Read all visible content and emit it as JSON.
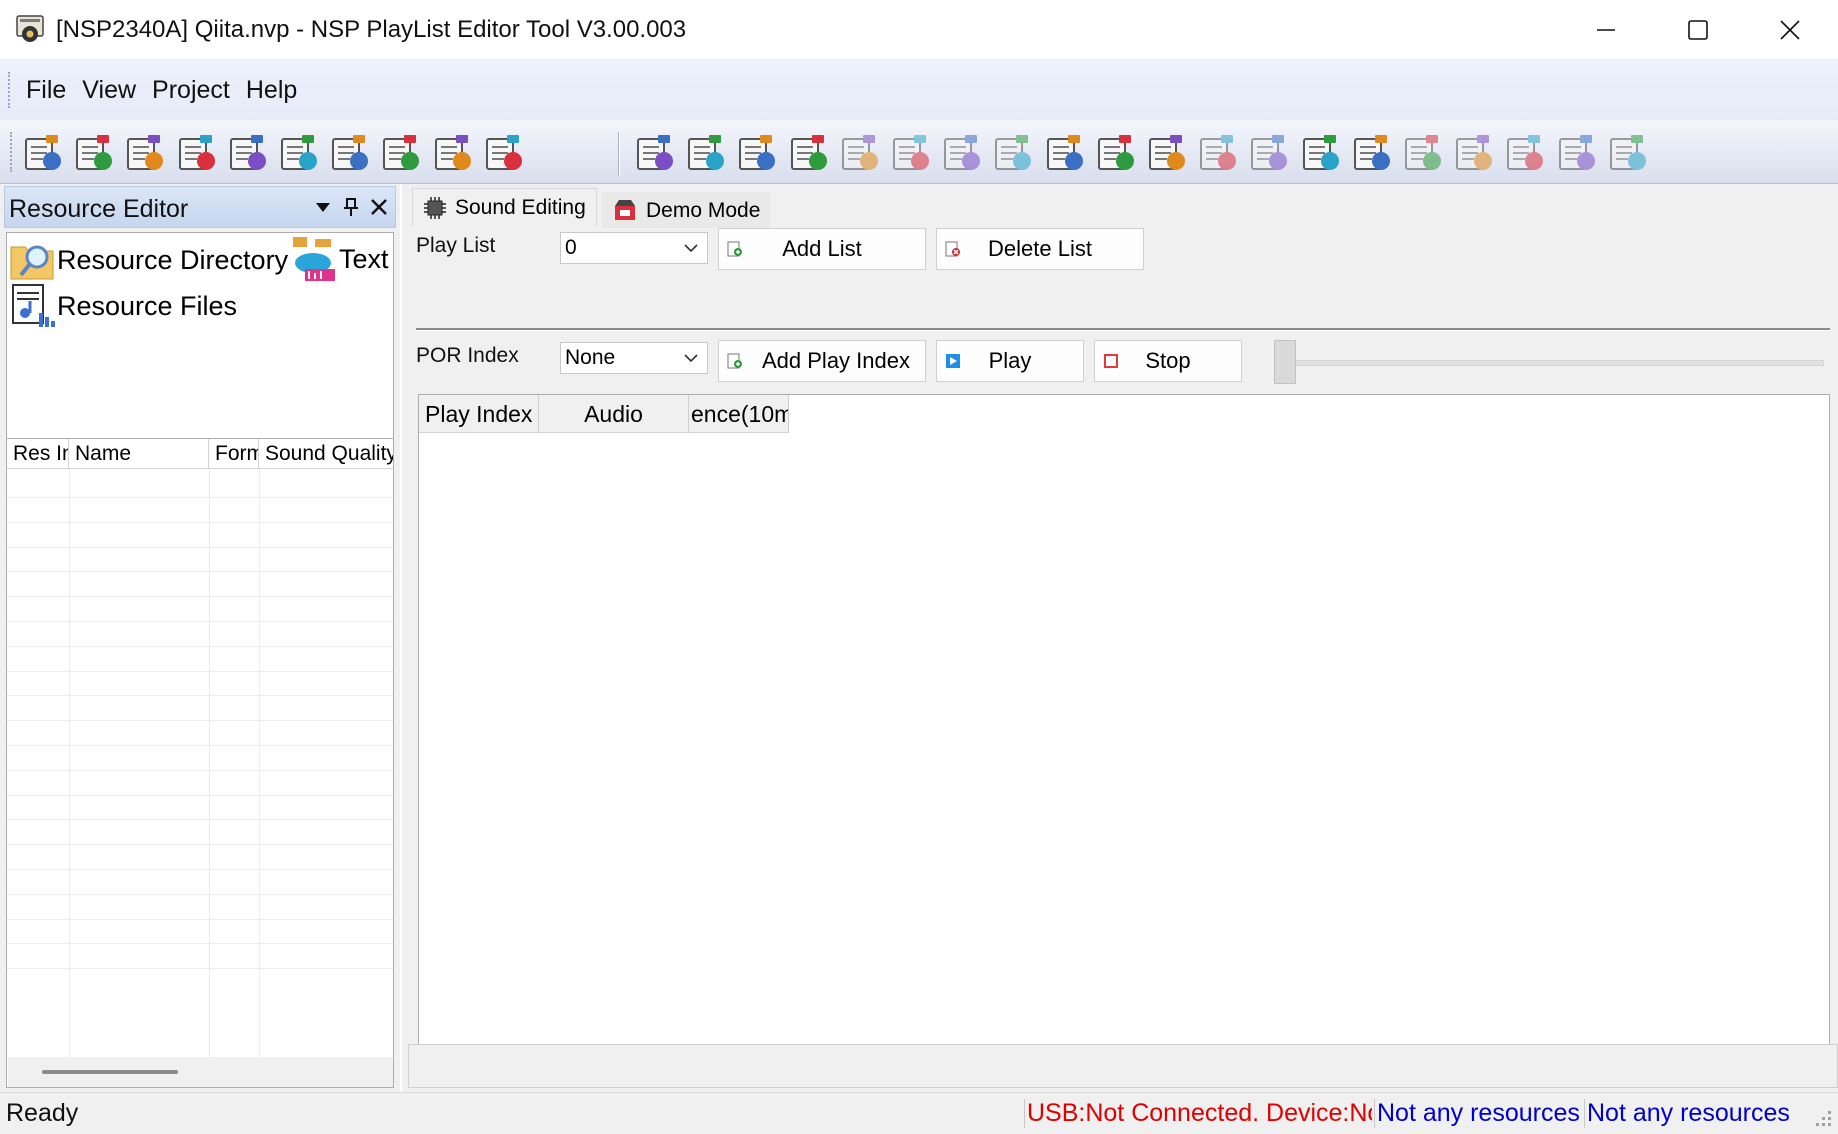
{
  "window": {
    "title": "[NSP2340A] Qiita.nvp - NSP PlayList Editor Tool V3.00.003"
  },
  "menu": [
    "File",
    "View",
    "Project",
    "Help"
  ],
  "toolbar_icons": [
    "new-project-icon",
    "import-project-icon",
    "save-icon",
    "save-as-icon",
    "add-window-icon",
    "export-icon",
    "open-folder-icon",
    "import-file-icon",
    "add-file-icon",
    "export-file-icon",
    "compile-icon",
    "download-icon",
    "burn-chip-icon",
    "burn-all-icon",
    "document-burn-icon",
    "delete-all-icon",
    "run-icon",
    "stop-run-icon",
    "chip-info-icon",
    "settings-gear-icon",
    "edit-note-icon",
    "console-icon",
    "refresh-window-icon",
    "music-level-icon",
    "upload-icon",
    "touch-icon",
    "touch-download-icon",
    "touch-settings-icon",
    "network-icon",
    "database-icon"
  ],
  "resource_editor": {
    "title": "Resource Editor",
    "items": [
      {
        "label": "Resource Directory",
        "icon": "resource-directory-icon"
      },
      {
        "label": "Text",
        "icon": "text-to-speech-icon"
      },
      {
        "label": "Resource Files",
        "icon": "resource-files-icon"
      }
    ],
    "grid_columns": [
      "Res Index",
      "Name",
      "Format",
      "Sound Quality"
    ]
  },
  "tabs": [
    {
      "label": "Sound Editing",
      "active": true,
      "icon": "chip-icon"
    },
    {
      "label": "Demo Mode",
      "active": false,
      "icon": "demo-mode-icon"
    }
  ],
  "sound_editing": {
    "play_list_label": "Play List",
    "play_list_value": "0",
    "add_list_label": "Add List",
    "delete_list_label": "Delete List",
    "por_index_label": "POR Index",
    "por_index_value": "None",
    "add_play_index_label": "Add Play Index",
    "play_label": "Play",
    "stop_label": "Stop",
    "playback_position": 0,
    "grid_columns": [
      "Play Index",
      "Audio",
      "ence(10m"
    ]
  },
  "status": {
    "ready": "Ready",
    "usb": "USB:Not Connected. Device:Not Connected.",
    "resources_1": "Not any resources",
    "resources_2": "Not any resources"
  },
  "colors": {
    "status_error": "#e00000",
    "status_info": "#0000cc",
    "panel_header": "#c5d6ee"
  }
}
